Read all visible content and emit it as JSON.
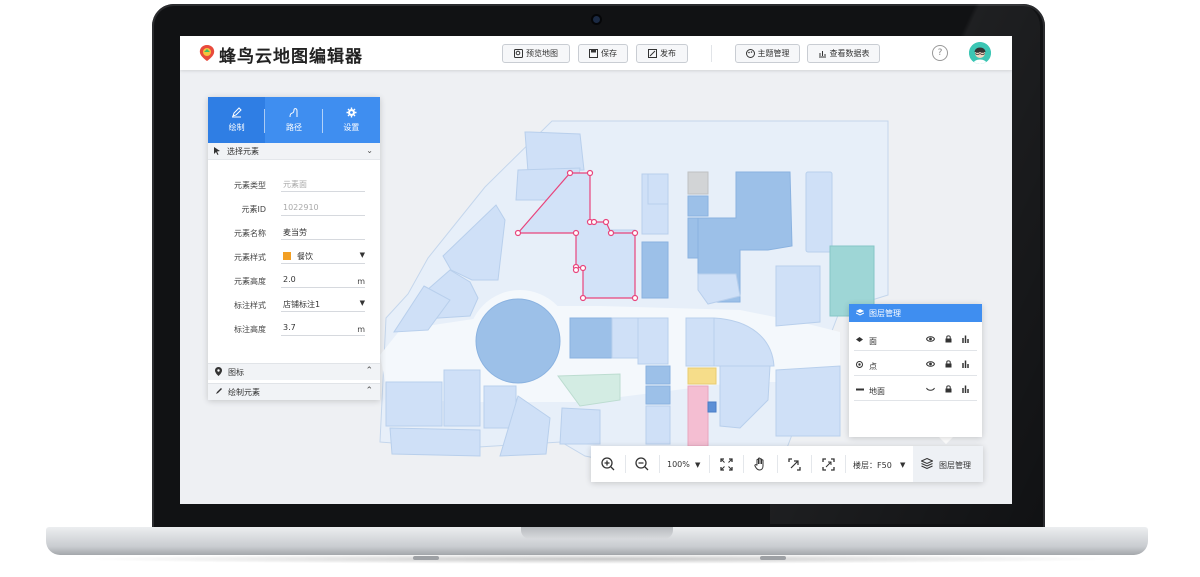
{
  "app": {
    "title": "蜂鸟云地图编辑器"
  },
  "header_buttons": {
    "preview": "预览地图",
    "save": "保存",
    "publish": "发布",
    "theme": "主题管理",
    "view_data": "查看数据表"
  },
  "header_icons": {
    "help": "?",
    "help_icon": "question-circle-icon",
    "avatar_icon": "user-avatar-icon"
  },
  "panel": {
    "tabs": [
      {
        "label": "绘制",
        "icon": "pencil-icon",
        "active": true
      },
      {
        "label": "路径",
        "icon": "path-icon",
        "active": false
      },
      {
        "label": "设置",
        "icon": "gear-icon",
        "active": false
      }
    ],
    "section_title": "选择元素",
    "fields": {
      "type": {
        "label": "元素类型",
        "value": "元素面"
      },
      "id": {
        "label": "元素ID",
        "value": "1022910"
      },
      "name": {
        "label": "元素名称",
        "value": "麦当劳"
      },
      "style": {
        "label": "元素样式",
        "value": "餐饮",
        "color": "#f29f24"
      },
      "height": {
        "label": "元素高度",
        "value": "2.0",
        "unit": "m"
      },
      "label_style": {
        "label": "标注样式",
        "value": "店铺标注1"
      },
      "label_height": {
        "label": "标注高度",
        "value": "3.7",
        "unit": "m"
      }
    },
    "folds": {
      "icons": "图标",
      "draw_elements": "绘制元素"
    }
  },
  "layers_panel": {
    "title": "图层管理",
    "rows": [
      {
        "label": "面"
      },
      {
        "label": "点"
      },
      {
        "label": "地面"
      }
    ]
  },
  "toolbar": {
    "zoom": "100%",
    "floor_label": "楼层：",
    "floor_value": "F50",
    "layer_button": "图层管理"
  },
  "colors": {
    "accent": "#3f8ef0",
    "selection": "#e8447c",
    "map_fill": "#cfe0f7",
    "map_dark": "#9cc0e8"
  }
}
